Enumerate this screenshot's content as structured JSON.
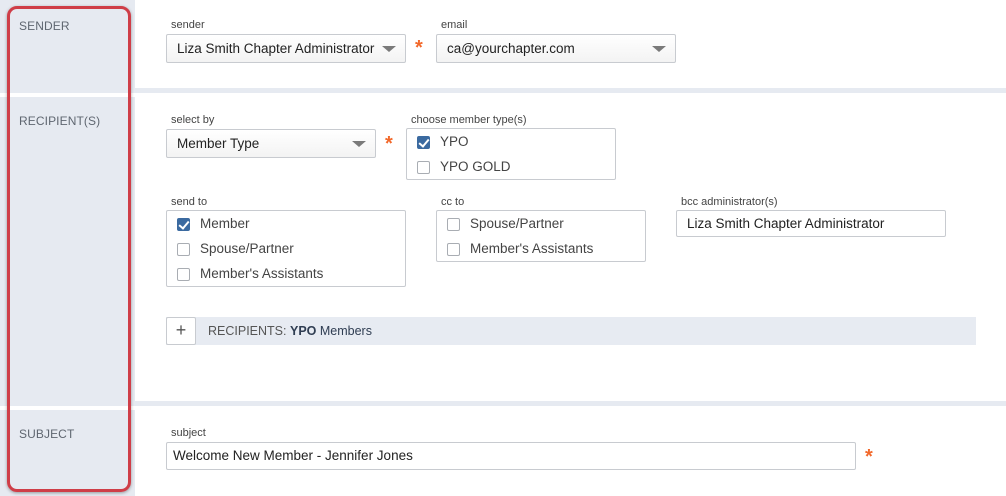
{
  "sections": {
    "sender": "SENDER",
    "recipients": "RECIPIENT(S)",
    "subject": "SUBJECT"
  },
  "sender": {
    "sender_label": "sender",
    "sender_value": "Liza Smith Chapter Administrator",
    "email_label": "email",
    "email_value": "ca@yourchapter.com"
  },
  "recipients": {
    "select_by_label": "select by",
    "select_by_value": "Member Type",
    "member_type_label": "choose member type(s)",
    "member_types": [
      {
        "label": "YPO",
        "checked": true
      },
      {
        "label": "YPO GOLD",
        "checked": false
      }
    ],
    "send_to_label": "send to",
    "send_to": [
      {
        "label": "Member",
        "checked": true
      },
      {
        "label": "Spouse/Partner",
        "checked": false
      },
      {
        "label": "Member's Assistants",
        "checked": false
      }
    ],
    "cc_to_label": "cc to",
    "cc_to": [
      {
        "label": "Spouse/Partner",
        "checked": false
      },
      {
        "label": "Member's Assistants",
        "checked": false
      }
    ],
    "bcc_label": "bcc administrator(s)",
    "bcc_value": "Liza Smith Chapter Administrator",
    "summary_prefix": "RECIPIENTS:",
    "summary_type": "YPO",
    "summary_suffix": "Members",
    "add_symbol": "+"
  },
  "subject": {
    "label": "subject",
    "value": "Welcome New Member - Jennifer Jones"
  },
  "required_marker": "*",
  "colors": {
    "accent_blue": "#3b6aa0",
    "required_orange": "#f2682a",
    "highlight_red": "#cf3e48",
    "panel_bg": "#e6eaf1"
  }
}
